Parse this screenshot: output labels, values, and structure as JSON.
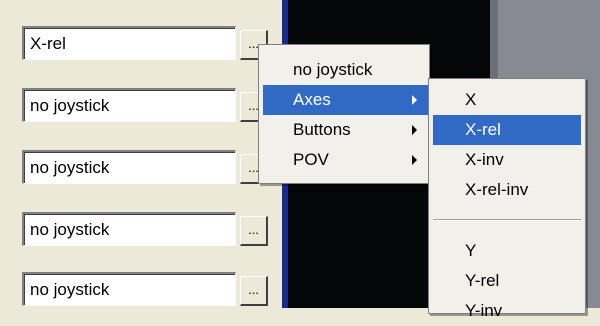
{
  "fields": [
    {
      "value": "X-rel",
      "button_label": "..."
    },
    {
      "value": "no joystick",
      "button_label": "..."
    },
    {
      "value": "no joystick",
      "button_label": "..."
    },
    {
      "value": "no joystick",
      "button_label": "..."
    },
    {
      "value": "no joystick",
      "button_label": "..."
    }
  ],
  "menu": {
    "items": [
      {
        "label": "no joystick",
        "has_submenu": false
      },
      {
        "label": "Axes",
        "has_submenu": true,
        "selected": true
      },
      {
        "label": "Buttons",
        "has_submenu": true
      },
      {
        "label": "POV",
        "has_submenu": true
      }
    ]
  },
  "submenu": {
    "items": [
      "X",
      "X-rel",
      "X-inv",
      "X-rel-inv",
      "Y",
      "Y-rel",
      "Y-inv"
    ],
    "selected": "X-rel"
  },
  "colors": {
    "selection": "#316ac5"
  }
}
